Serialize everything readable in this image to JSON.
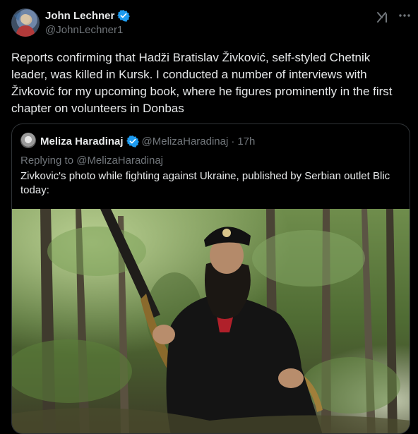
{
  "tweet": {
    "author": {
      "name": "John Lechner",
      "handle": "@JohnLechner1",
      "verified": true,
      "verified_color": "#1d9bf0"
    },
    "text": "Reports confirming that Hadži Bratislav Živković, self-styled Chetnik leader, was killed in Kursk. I conducted a number of interviews with Živković for my upcoming book, where he figures prominently in the first chapter on volunteers in Donbas",
    "header_icons": [
      "grok-icon",
      "more-icon"
    ]
  },
  "quoted_tweet": {
    "author_name": "Meliza Haradinaj",
    "handle": "@MelizaHaradinaj",
    "separator": "·",
    "time": "17h",
    "verified": true,
    "replying_to": "Replying to @MelizaHaradinaj",
    "text": "Zivkovic's photo while fighting against Ukraine, published by Serbian outlet Blic today:",
    "photo": "bearded-man-with-machine-gun-in-forest-photo"
  },
  "colors": {
    "background": "#000000",
    "text_primary": "#e7e9ea",
    "text_secondary": "#71767b",
    "border": "#2f3336",
    "accent": "#1d9bf0"
  }
}
